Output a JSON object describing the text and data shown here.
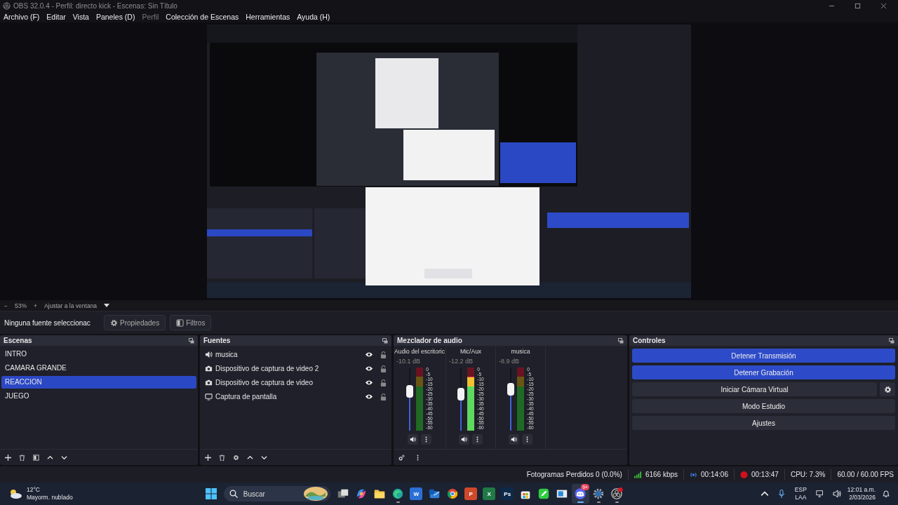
{
  "window": {
    "title": "OBS 32.0.4 - Perfil: directo kick - Escenas: Sin Título"
  },
  "menu": [
    {
      "label": "Archivo (F)",
      "disabled": false
    },
    {
      "label": "Editar",
      "disabled": false
    },
    {
      "label": "Vista",
      "disabled": false
    },
    {
      "label": "Paneles (D)",
      "disabled": false
    },
    {
      "label": "Perfil",
      "disabled": true
    },
    {
      "label": "Colección de Escenas",
      "disabled": false
    },
    {
      "label": "Herramientas",
      "disabled": false
    },
    {
      "label": "Ayuda (H)",
      "disabled": false
    }
  ],
  "zoom_bar": {
    "minus": "−",
    "zoom": "53%",
    "plus": "+",
    "fit": "Ajustar a la ventana"
  },
  "source_toolbar": {
    "selection": "Ninguna fuente seleccionac",
    "buttons": [
      {
        "label": "Propiedades",
        "kind": "properties"
      },
      {
        "label": "Filtros",
        "kind": "filters"
      }
    ]
  },
  "scenes": {
    "title": "Escenas",
    "items": [
      {
        "label": "INTRO",
        "selected": false
      },
      {
        "label": "CAMARA GRANDE",
        "selected": false
      },
      {
        "label": "REACCION",
        "selected": true
      },
      {
        "label": "JUEGO",
        "selected": false
      }
    ]
  },
  "sources": {
    "title": "Fuentes",
    "items": [
      {
        "label": "musica",
        "kind": "audio",
        "visible": true,
        "locked": false
      },
      {
        "label": "Dispositivo de captura de video 2",
        "kind": "camera",
        "visible": true,
        "locked": false
      },
      {
        "label": "Dispositivo de captura de video",
        "kind": "camera",
        "visible": true,
        "locked": false
      },
      {
        "label": "Captura de pantalla",
        "kind": "display",
        "visible": true,
        "locked": false
      }
    ]
  },
  "mixer": {
    "title": "Mezclador de audio",
    "channels": [
      {
        "name": "Audio del escritoric",
        "reading": "-10.1 dB",
        "fader": {
          "level": 0.62
        },
        "scale": [
          "0",
          "-5",
          "-10",
          "-15",
          "-20",
          "-25",
          "-30",
          "-35",
          "-40",
          "-45",
          "-50",
          "-55",
          "-60"
        ]
      },
      {
        "name": "Mic/Aux",
        "reading": "-12.2 dB",
        "fader": {
          "level": 0.58
        },
        "meter": {
          "level": 0.86
        },
        "scale": [
          "0",
          "-5",
          "-10",
          "-15",
          "-20",
          "-25",
          "-30",
          "-35",
          "-40",
          "-45",
          "-50",
          "-55",
          "-60"
        ]
      },
      {
        "name": "musica",
        "reading": "-8.9 dB",
        "fader": {
          "level": 0.66
        },
        "scale": [
          "0",
          "-5",
          "-10",
          "-15",
          "-20",
          "-25",
          "-30",
          "-35",
          "-40",
          "-45",
          "-50",
          "-55",
          "-60"
        ]
      }
    ]
  },
  "controls": {
    "title": "Controles",
    "buttons": [
      {
        "label": "Detener Transmisión",
        "active": true,
        "settings": false
      },
      {
        "label": "Detener Grabación",
        "active": true,
        "settings": false
      },
      {
        "label": "Iniciar Cámara Virtual",
        "active": false,
        "settings": true
      },
      {
        "label": "Modo Estudio",
        "active": false,
        "settings": false
      },
      {
        "label": "Ajustes",
        "active": false,
        "settings": false
      }
    ]
  },
  "status_bar": {
    "dropped": "Fotogramas Perdidos 0 (0.0%)",
    "bitrate": "6166 kbps",
    "stream_time": "00:14:06",
    "record_time": "00:13:47",
    "cpu": "CPU: 7.3%",
    "fps": "60.00 / 60.00 FPS"
  },
  "taskbar": {
    "weather": {
      "temp": "12°C",
      "desc": "Mayorm. nublado"
    },
    "search": {
      "placeholder": "Buscar"
    },
    "apps": [
      {
        "kind": "taskview",
        "running": false,
        "active": false
      },
      {
        "kind": "copilot",
        "running": false,
        "active": false
      },
      {
        "kind": "folder",
        "running": false,
        "active": false
      },
      {
        "kind": "browser",
        "running": true,
        "active": false
      },
      {
        "kind": "tile",
        "glyph": "W",
        "color": "#2b6fd6",
        "running": false,
        "active": false
      },
      {
        "kind": "mail",
        "running": false,
        "active": false
      },
      {
        "kind": "chrome",
        "running": false,
        "active": false
      },
      {
        "kind": "tile",
        "glyph": "P",
        "color": "#d0482a",
        "running": false,
        "active": false
      },
      {
        "kind": "tile",
        "glyph": "X",
        "color": "#1f7a45",
        "running": false,
        "active": false
      },
      {
        "kind": "tile",
        "glyph": "Ps",
        "color": "#0e2a4a",
        "running": false,
        "active": false
      },
      {
        "kind": "store",
        "running": false,
        "active": false
      },
      {
        "kind": "pen",
        "running": false,
        "active": false
      },
      {
        "kind": "window",
        "running": false,
        "active": false
      },
      {
        "kind": "chat",
        "badge": "9+",
        "running": true,
        "active": true
      },
      {
        "kind": "gear",
        "running": true,
        "active": false
      },
      {
        "kind": "record",
        "running": true,
        "active": false,
        "notify": true
      }
    ],
    "tray": {
      "lang": "ESP",
      "layout": "LAA",
      "time": "12:01 a.m.",
      "date": "2/03/2026"
    }
  }
}
